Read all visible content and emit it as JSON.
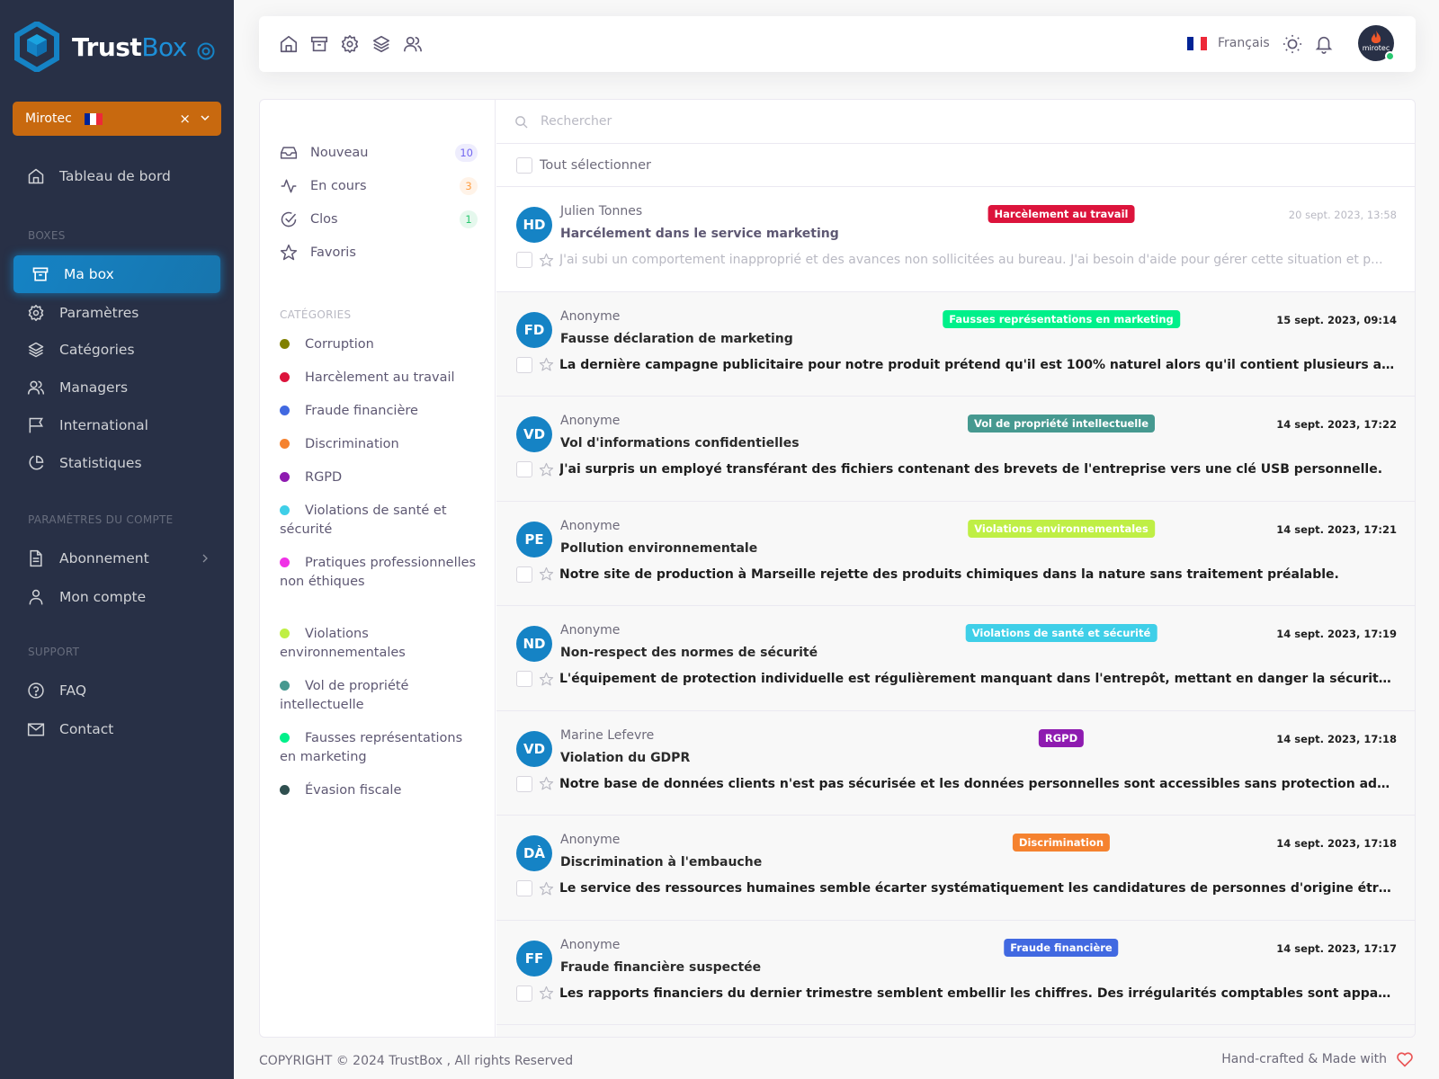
{
  "brand": {
    "name_part1": "Trust",
    "name_part2": "Box"
  },
  "company_select": {
    "value": "Mirotec",
    "clear": "×"
  },
  "sidebar": {
    "dashboard": "Tableau de bord",
    "sections": {
      "boxes": "BOXES",
      "account": "PARAMÈTRES DU COMPTE",
      "support": "SUPPORT"
    },
    "items": [
      {
        "label": "Ma box",
        "icon": "archive-icon",
        "active": true
      },
      {
        "label": "Paramètres",
        "icon": "settings-icon"
      },
      {
        "label": "Catégories",
        "icon": "layers-icon"
      },
      {
        "label": "Managers",
        "icon": "users-icon"
      },
      {
        "label": "International",
        "icon": "flag-icon"
      },
      {
        "label": "Statistiques",
        "icon": "pie-chart-icon"
      },
      {
        "label": "Abonnement",
        "icon": "file-text-icon"
      },
      {
        "label": "Mon compte",
        "icon": "user-icon"
      },
      {
        "label": "FAQ",
        "icon": "help-circle-icon"
      },
      {
        "label": "Contact",
        "icon": "mail-icon"
      }
    ]
  },
  "topbar": {
    "icons": [
      "home-icon",
      "archive-icon",
      "settings-icon",
      "layers-icon",
      "users-icon"
    ],
    "language": "Français",
    "user_avatar_label": "mirotec",
    "user_status": "online"
  },
  "filters": [
    {
      "label": "Nouveau",
      "count": "10",
      "icon": "inbox-icon",
      "badge_bg": "#eeedfd",
      "badge_color": "#7367f0"
    },
    {
      "label": "En cours",
      "count": "3",
      "icon": "activity-icon",
      "badge_bg": "#fff3e8",
      "badge_color": "#ff9f43"
    },
    {
      "label": "Clos",
      "count": "1",
      "icon": "check-circle-icon",
      "badge_bg": "#e5f8ed",
      "badge_color": "#28c76f"
    },
    {
      "label": "Favoris",
      "count": null,
      "icon": "star-icon"
    }
  ],
  "categories": {
    "header": "CATÉGORIES",
    "items": [
      {
        "label": "Corruption",
        "color": "#808000"
      },
      {
        "label": "Harcèlement au travail",
        "color": "#dc143c"
      },
      {
        "label": "Fraude financière",
        "color": "#4169e1"
      },
      {
        "label": "Discrimination",
        "color": "#f5822f"
      },
      {
        "label": "RGPD",
        "color": "#8e1bb0"
      },
      {
        "label": "Violations de santé et sécurité",
        "color": "#3fcfe8"
      },
      {
        "label": "Pratiques professionnelles non éthiques",
        "color": "#f032e6"
      },
      {
        "label": "Violations environnementales",
        "color": "#bfef45"
      },
      {
        "label": "Vol de propriété intellectuelle",
        "color": "#469990"
      },
      {
        "label": "Fausses représentations en marketing",
        "color": "#00f08a"
      },
      {
        "label": "Évasion fiscale",
        "color": "#2f4f4f"
      }
    ]
  },
  "search": {
    "placeholder": "Rechercher",
    "value": ""
  },
  "select_all": "Tout sélectionner",
  "messages": [
    {
      "initials": "HD",
      "sender": "Julien Tonnes",
      "subject": "Harcélement dans le service marketing",
      "tag": "Harcèlement au travail",
      "tag_color": "#dc143c",
      "date": "20 sept. 2023, 13:58",
      "preview": "J'ai subi un comportement inapproprié et des avances non sollicitées au bureau. J'ai besoin d'aide pour gérer cette situation et p...",
      "read": true
    },
    {
      "initials": "FD",
      "sender": "Anonyme",
      "subject": "Fausse déclaration de marketing",
      "tag": "Fausses représentations en marketing",
      "tag_color": "#00f08a",
      "date": "15 sept. 2023, 09:14",
      "preview": "La dernière campagne publicitaire pour notre produit prétend qu'il est 100% naturel alors qu'il contient plusieurs additifs syn..."
    },
    {
      "initials": "VD",
      "sender": "Anonyme",
      "subject": "Vol d'informations confidentielles",
      "tag": "Vol de propriété intellectuelle",
      "tag_color": "#469990",
      "date": "14 sept. 2023, 17:22",
      "preview": "J'ai surpris un employé transférant des fichiers contenant des brevets de l'entreprise vers une clé USB personnelle."
    },
    {
      "initials": "PE",
      "sender": "Anonyme",
      "subject": "Pollution environnementale",
      "tag": "Violations environnementales",
      "tag_color": "#bfef45",
      "date": "14 sept. 2023, 17:21",
      "preview": "Notre site de production à Marseille rejette des produits chimiques dans la nature sans traitement préalable."
    },
    {
      "initials": "ND",
      "sender": "Anonyme",
      "subject": "Non-respect des normes de sécurité",
      "tag": "Violations de santé et sécurité",
      "tag_color": "#3fcfe8",
      "date": "14 sept. 2023, 17:19",
      "preview": "L'équipement de protection individuelle est régulièrement manquant dans l'entrepôt, mettant en danger la sécurité des em..."
    },
    {
      "initials": "VD",
      "sender": "Marine Lefevre",
      "subject": "Violation du GDPR",
      "tag": "RGPD",
      "tag_color": "#8e1bb0",
      "date": "14 sept. 2023, 17:18",
      "preview": "Notre base de données clients n'est pas sécurisée et les données personnelles sont accessibles sans protection adéquate."
    },
    {
      "initials": "DÀ",
      "sender": "Anonyme",
      "subject": "Discrimination à l'embauche",
      "tag": "Discrimination",
      "tag_color": "#f5822f",
      "date": "14 sept. 2023, 17:18",
      "preview": "Le service des ressources humaines semble écarter systématiquement les candidatures de personnes d'origine étrangère."
    },
    {
      "initials": "FF",
      "sender": "Anonyme",
      "subject": "Fraude financière suspectée",
      "tag": "Fraude financière",
      "tag_color": "#4169e1",
      "date": "14 sept. 2023, 17:17",
      "preview": "Les rapports financiers du dernier trimestre semblent embellir les chiffres. Des irrégularités comptables sont apparentes."
    }
  ],
  "footer": {
    "copyright": "COPYRIGHT © 2024 TrustBox , All rights Reserved",
    "made_with": "Hand-crafted & Made with"
  },
  "colors": {
    "sidebar_bg": "#283046",
    "accent": "#1583c5",
    "company_select_bg": "#c8690f"
  }
}
